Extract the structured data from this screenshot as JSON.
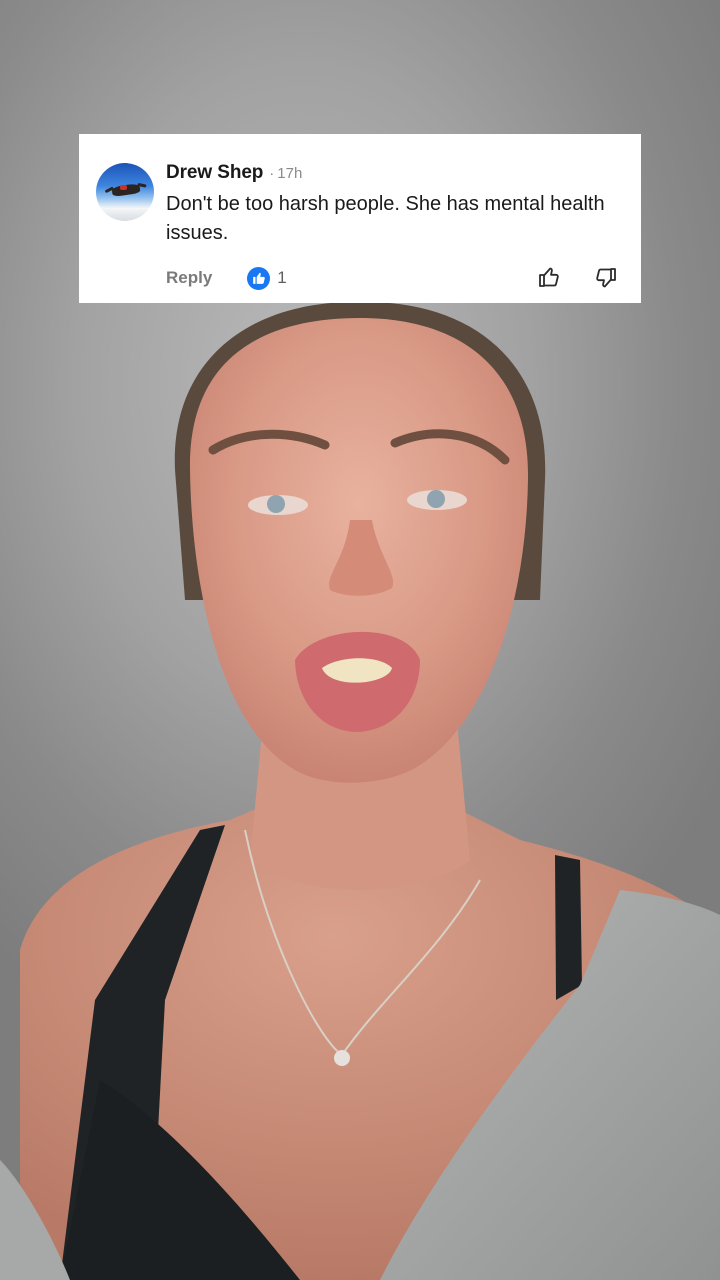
{
  "comment": {
    "author": "Drew Shep",
    "separator": "·",
    "time": "17h",
    "text": "Don't be too harsh people. She has mental health issues.",
    "reply_label": "Reply",
    "reaction_count": "1",
    "reaction_icon": "thumbs-up-icon",
    "accent_color": "#1877f2"
  },
  "avatar": {
    "icon": "skydiver-avatar"
  }
}
